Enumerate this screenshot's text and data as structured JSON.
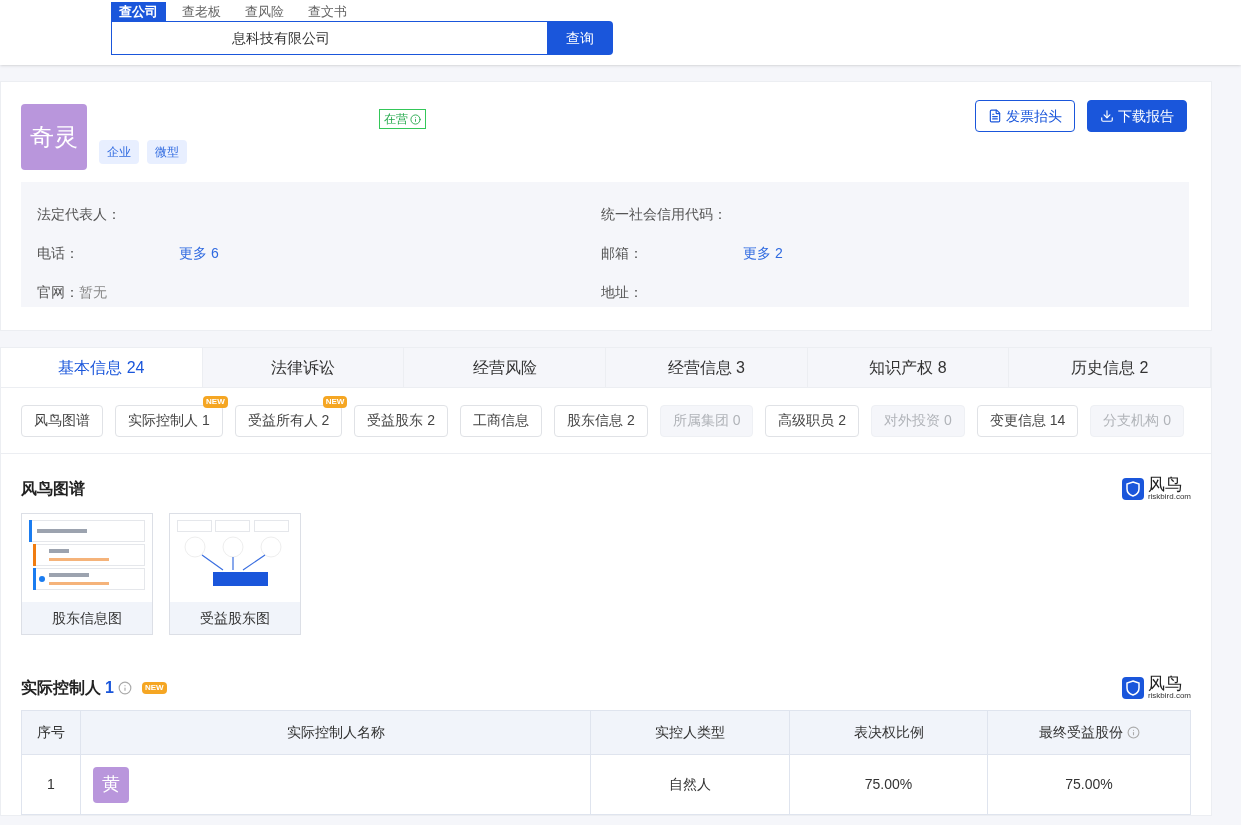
{
  "search": {
    "tabs": [
      {
        "label": "查公司",
        "selected": true
      },
      {
        "label": "查老板",
        "selected": false
      },
      {
        "label": "查风险",
        "selected": false
      },
      {
        "label": "查文书",
        "selected": false
      }
    ],
    "value": "息科技有限公司",
    "button": "查询"
  },
  "company": {
    "avatar": "奇灵",
    "status": "在营",
    "tags": [
      "企业",
      "微型"
    ],
    "buttons": [
      {
        "kind": "outline",
        "label": "发票抬头"
      },
      {
        "kind": "primary",
        "label": "下载报告"
      }
    ],
    "fields": [
      {
        "label": "法定代表人："
      },
      {
        "label": "统一社会信用代码："
      },
      {
        "label": "电话：",
        "link": "更多 6"
      },
      {
        "label": "邮箱：",
        "link": "更多 2"
      },
      {
        "label": "官网：",
        "value": "暂无"
      },
      {
        "label": "地址："
      }
    ]
  },
  "main_tabs": [
    {
      "label": "基本信息 24",
      "selected": true
    },
    {
      "label": "法律诉讼",
      "selected": false
    },
    {
      "label": "经营风险",
      "selected": false
    },
    {
      "label": "经营信息 3",
      "selected": false
    },
    {
      "label": "知识产权 8",
      "selected": false
    },
    {
      "label": "历史信息 2",
      "selected": false
    }
  ],
  "chips": [
    {
      "label": "风鸟图谱",
      "disabled": false
    },
    {
      "label": "实际控制人 1",
      "disabled": false,
      "badge": "NEW"
    },
    {
      "label": "受益所有人 2",
      "disabled": false,
      "badge": "NEW"
    },
    {
      "label": "受益股东 2",
      "disabled": false
    },
    {
      "label": "工商信息",
      "disabled": false
    },
    {
      "label": "股东信息 2",
      "disabled": false
    },
    {
      "label": "所属集团 0",
      "disabled": true
    },
    {
      "label": "高级职员 2",
      "disabled": false
    },
    {
      "label": "对外投资 0",
      "disabled": true
    },
    {
      "label": "变更信息 14",
      "disabled": false
    },
    {
      "label": "分支机构 0",
      "disabled": true
    }
  ],
  "graph_section": {
    "title": "风鸟图谱",
    "logo": {
      "name": "风鸟",
      "domain": "riskbird.com"
    },
    "cards": [
      {
        "kind": "shareholder",
        "label": "股东信息图"
      },
      {
        "kind": "beneficiary",
        "label": "受益股东图"
      }
    ]
  },
  "controller_section": {
    "title": "实际控制人",
    "count": "1",
    "badge": "NEW",
    "logo": {
      "name": "风鸟",
      "domain": "riskbird.com"
    },
    "columns": [
      "序号",
      "实际控制人名称",
      "实控人类型",
      "表决权比例",
      "最终受益股份"
    ],
    "rows": [
      {
        "index": "1",
        "avatar": "黄",
        "type": "自然人",
        "vote": "75.00%",
        "share": "75.00%"
      }
    ]
  }
}
